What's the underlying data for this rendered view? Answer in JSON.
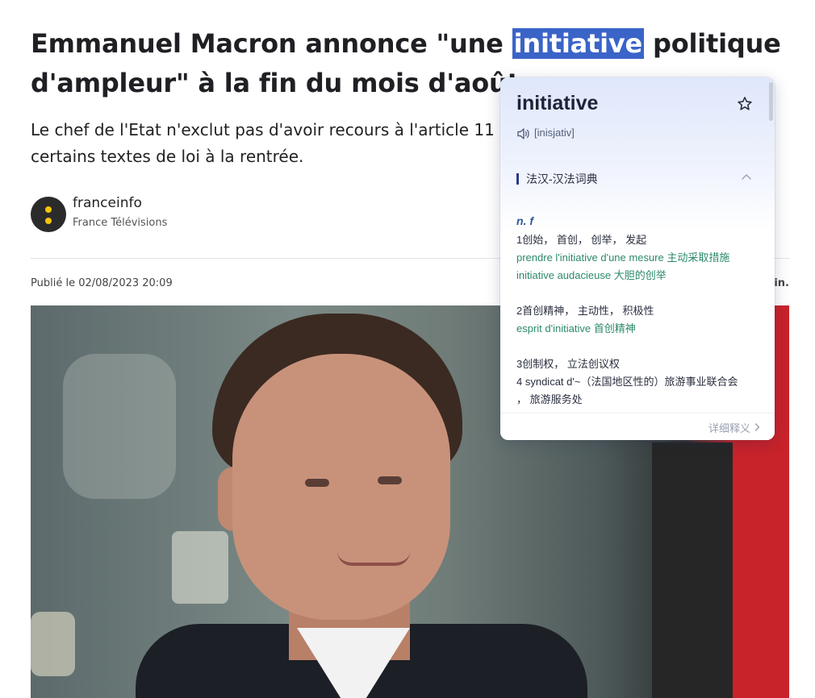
{
  "article": {
    "headline_before": "Emmanuel Macron annonce \"une ",
    "headline_selected": "initiative",
    "headline_after": " politique d'ampleur\" à la fin du mois d'août",
    "subtitle": "Le chef de l'Etat n'exclut pas d'avoir recours à l'article 11 de la Constitution pour soumettre certains textes de loi à la rentrée.",
    "author_name": "franceinfo",
    "author_org": "France Télévisions",
    "published": "Publié le 02/08/2023 20:09",
    "readtime_tail": "in."
  },
  "dictionary": {
    "word": "initiative",
    "pronunciation": "[inisjativ]",
    "source": "法汉-汉法词典",
    "pos": "n. f",
    "lines": [
      {
        "text": "1创始， 首创， 创举， 发起",
        "type": "def"
      },
      {
        "text": "prendre l'initiative d'une mesure 主动采取措施",
        "type": "ex"
      },
      {
        "text": "initiative audacieuse 大胆的创举",
        "type": "ex"
      },
      {
        "text": "2首创精神， 主动性， 积极性",
        "type": "def"
      },
      {
        "text": "esprit d'initiative 首创精神",
        "type": "ex"
      },
      {
        "text": "3创制权， 立法创议权",
        "type": "def"
      },
      {
        "text": "4 syndicat d'~（法国地区性的）旅游事业联合会",
        "type": "def"
      },
      {
        "text": "， 旅游服务处",
        "type": "def"
      }
    ],
    "more_label": "详细释义"
  },
  "colors": {
    "selection": "#3a64c8",
    "example_text": "#2c8a6a",
    "pos_text": "#2d5a9a",
    "flag_red": "#c8232a"
  },
  "icons": [
    "star-icon",
    "speaker-icon",
    "chevron-up-icon",
    "chevron-right-icon"
  ]
}
